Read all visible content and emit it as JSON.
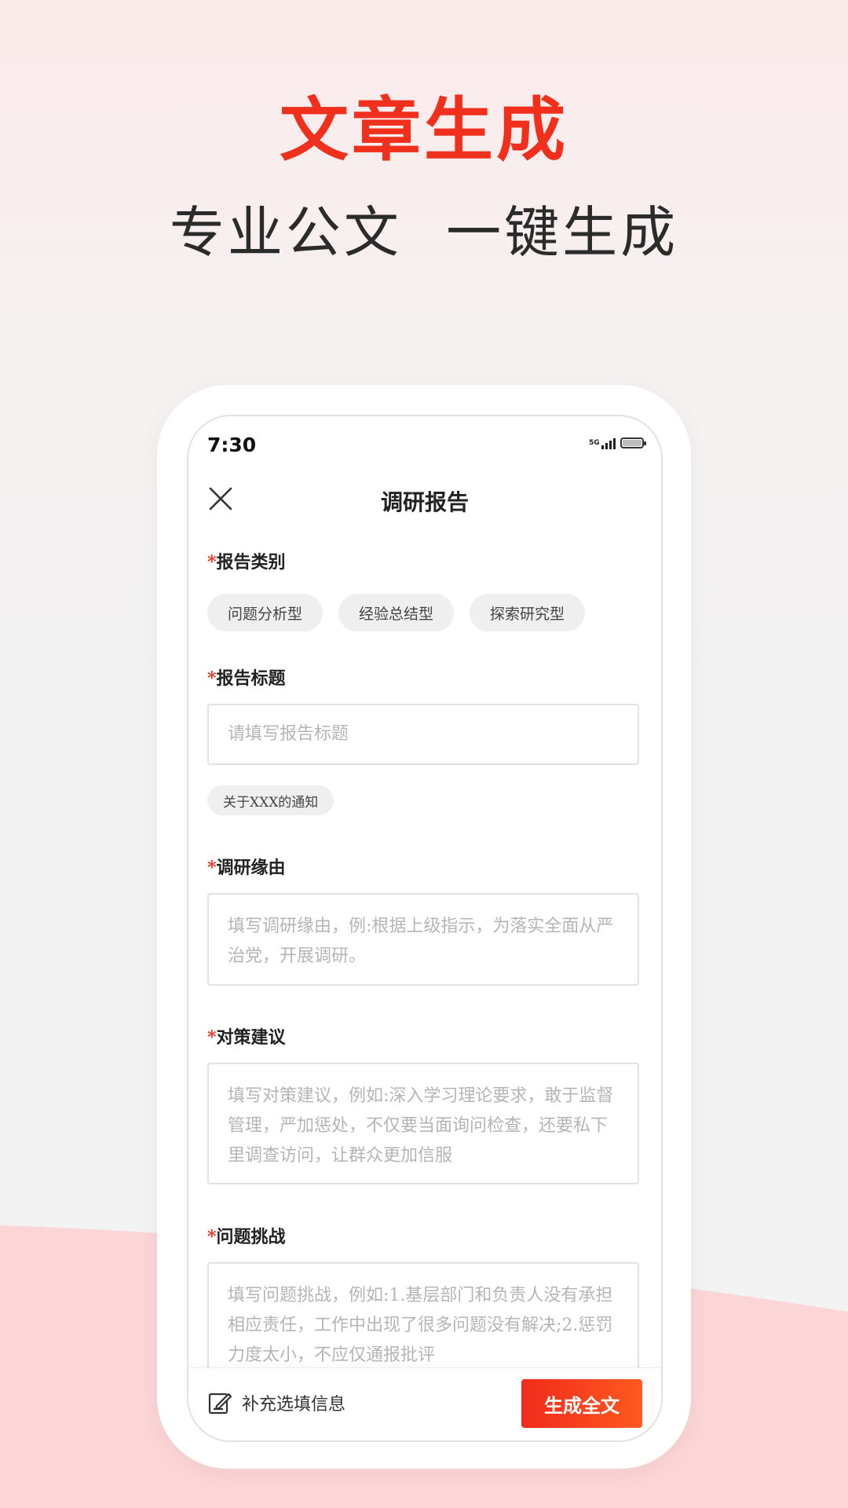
{
  "promo": {
    "headline": "文章生成",
    "subline": "专业公文  一键生成"
  },
  "colors": {
    "accent": "#f0301c",
    "button_gradient_end": "#ff5a20",
    "background_wave": "#fcd6d6"
  },
  "status_bar": {
    "time": "7:30",
    "network": "5G",
    "icons": [
      "signal-icon",
      "battery-icon"
    ]
  },
  "header": {
    "title": "调研报告",
    "close_icon": "close-icon"
  },
  "form": {
    "required_mark": "*",
    "category": {
      "label": "报告类别",
      "options": [
        "问题分析型",
        "经验总结型",
        "探索研究型"
      ]
    },
    "title": {
      "label": "报告标题",
      "placeholder": "请填写报告标题",
      "suggestion": "关于XXX的通知"
    },
    "reason": {
      "label": "调研缘由",
      "placeholder": "填写调研缘由，例:根据上级指示，为落实全面从严治党，开展调研。"
    },
    "suggestions": {
      "label": "对策建议",
      "placeholder": "填写对策建议，例如:深入学习理论要求，敢于监督管理，严加惩处，不仅要当面询问检查，还要私下里调查访问，让群众更加信服"
    },
    "challenges": {
      "label": "问题挑战",
      "placeholder": "填写问题挑战，例如:1.基层部门和负责人没有承担相应责任，工作中出现了很多问题没有解决;2.惩罚力度太小，不应仅通报批评"
    }
  },
  "bottom_bar": {
    "extra_info_label": "补充选填信息",
    "extra_info_icon": "edit-icon",
    "generate_label": "生成全文"
  }
}
